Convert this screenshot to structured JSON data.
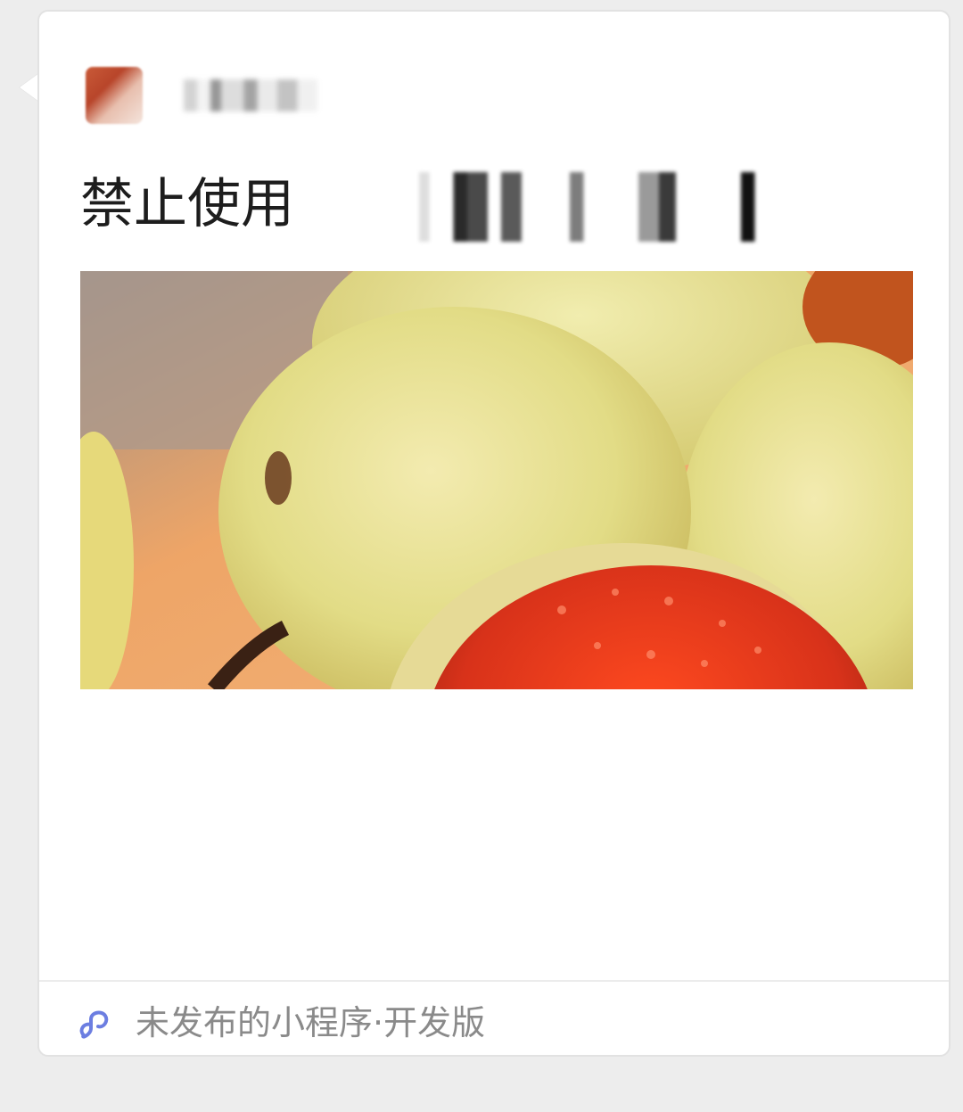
{
  "message": {
    "title": "禁止使用",
    "footer_label": "未发布的小程序·开发版"
  },
  "icons": {
    "avatar": "avatar-image",
    "mini_program": "mini-program-link-icon"
  },
  "colors": {
    "background": "#ededed",
    "card": "#ffffff",
    "title_text": "#1d1d1d",
    "footer_text": "#8a8a8a",
    "icon_accent": "#6c7ee1"
  }
}
